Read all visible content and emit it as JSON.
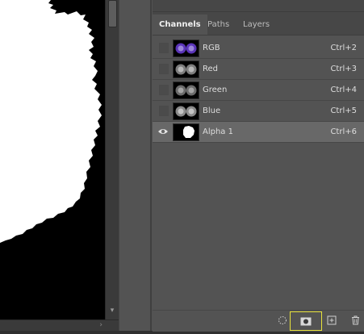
{
  "panel": {
    "tabs": [
      {
        "label": "Channels",
        "active": true
      },
      {
        "label": "Paths",
        "active": false
      },
      {
        "label": "Layers",
        "active": false
      }
    ],
    "channels": [
      {
        "name": "RGB",
        "shortcut": "Ctrl+2",
        "visible": false,
        "selected": false,
        "thumb": "rgb"
      },
      {
        "name": "Red",
        "shortcut": "Ctrl+3",
        "visible": false,
        "selected": false,
        "thumb": "gray"
      },
      {
        "name": "Green",
        "shortcut": "Ctrl+4",
        "visible": false,
        "selected": false,
        "thumb": "gray"
      },
      {
        "name": "Blue",
        "shortcut": "Ctrl+5",
        "visible": false,
        "selected": false,
        "thumb": "gray"
      },
      {
        "name": "Alpha 1",
        "shortcut": "Ctrl+6",
        "visible": true,
        "selected": true,
        "thumb": "alpha"
      }
    ],
    "footer_buttons": [
      "load-channel-as-selection-icon",
      "save-selection-as-channel-icon",
      "new-channel-icon",
      "trash-icon"
    ]
  },
  "colors": {
    "highlight": "#e8e23a",
    "selected_row": "#686868",
    "rgb_tint": "#6a3fc8"
  }
}
